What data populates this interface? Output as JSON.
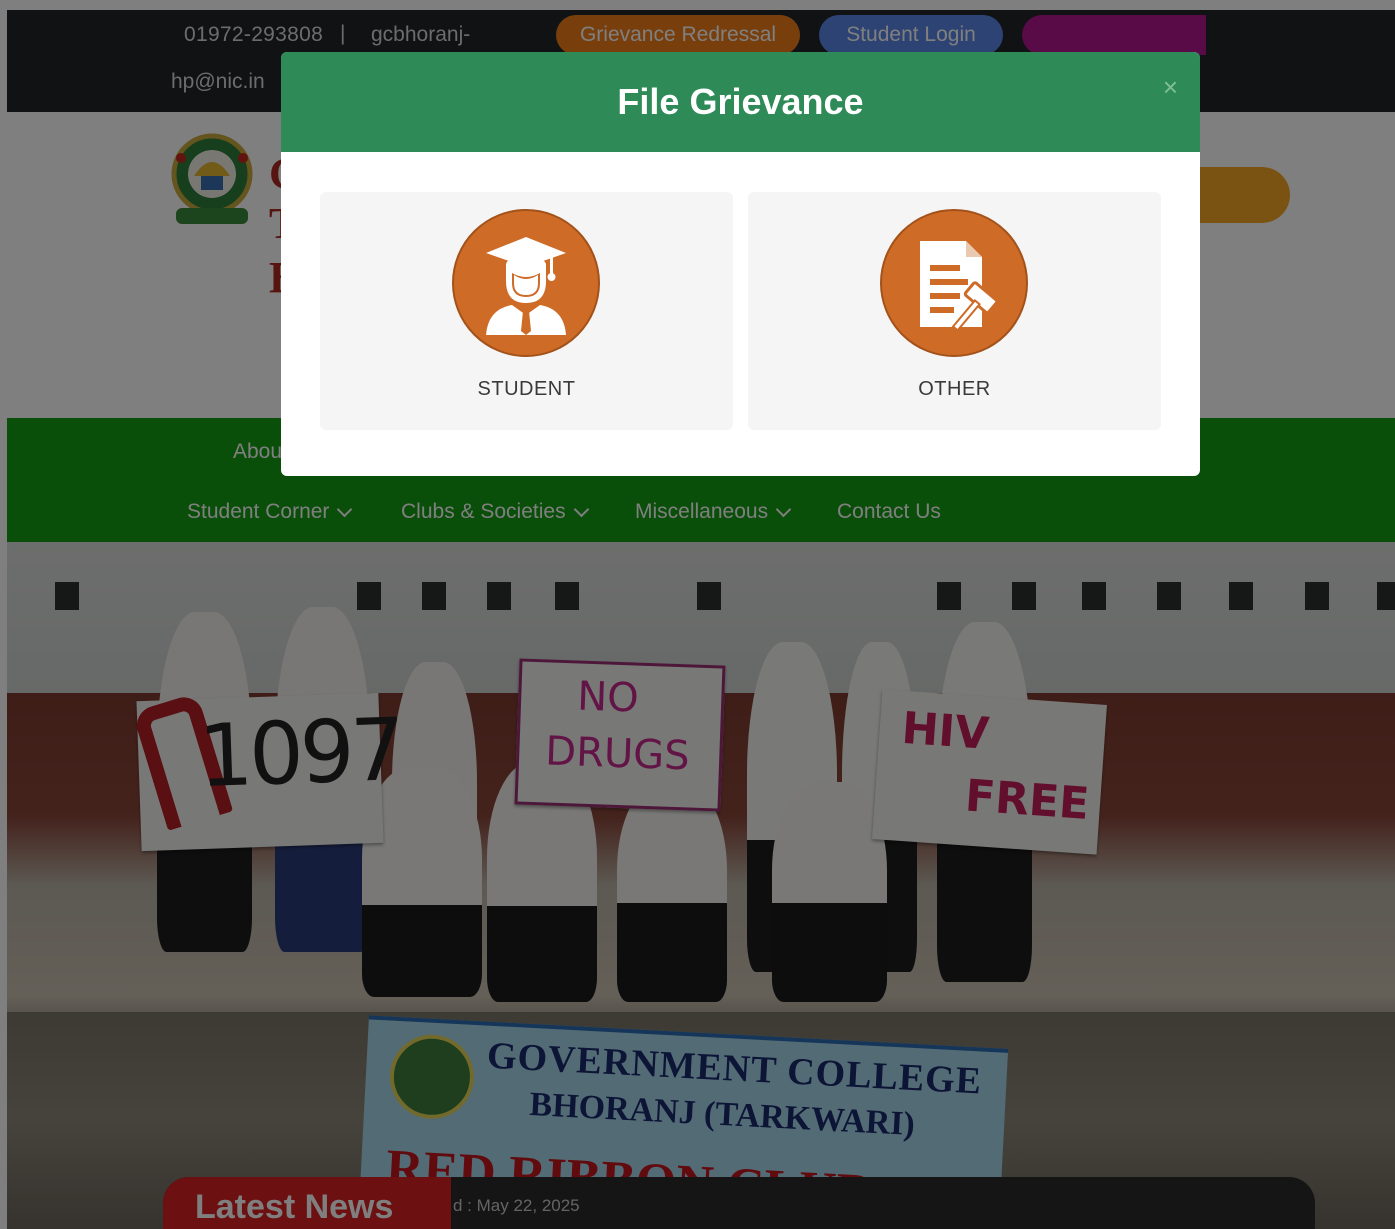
{
  "topbar": {
    "phone": "01972-293808",
    "separator": "|",
    "email_line1": "gcbhoranj-",
    "email_line2": "hp@nic.in",
    "grievance_button": "Grievance Redressal",
    "student_login_button": "Student Login"
  },
  "header": {
    "title_fragment_1": "G",
    "title_fragment_2": "T",
    "title_fragment_3": "B"
  },
  "nav": {
    "about_fragment": "Abou",
    "items": [
      {
        "label": "Student Corner",
        "has_dropdown": true
      },
      {
        "label": "Clubs & Societies",
        "has_dropdown": true
      },
      {
        "label": "Miscellaneous",
        "has_dropdown": true
      },
      {
        "label": "Contact Us",
        "has_dropdown": false
      }
    ]
  },
  "hero": {
    "sign_1": "1097",
    "sign_2_line1": "NO",
    "sign_2_line2": "DRUGS",
    "sign_3_line1": "HIV",
    "sign_3_line2": "FREE",
    "banner_line1": "GOVERNMENT COLLEGE",
    "banner_line2": "BHORANJ (TARKWARI)",
    "banner_line3": "RED RIBBON CLUB"
  },
  "news": {
    "label": "Latest News",
    "date_text": "d : May 22, 2025"
  },
  "modal": {
    "title": "File Grievance",
    "close_symbol": "×",
    "options": [
      {
        "label": "STUDENT",
        "icon": "graduate-icon"
      },
      {
        "label": "OTHER",
        "icon": "document-gavel-icon"
      }
    ]
  },
  "colors": {
    "modal_header": "#2e8b57",
    "icon_circle": "#cd6b27",
    "nav_green": "#129c12",
    "grievance_orange": "#f07f1a",
    "login_blue": "#5a87e8",
    "news_red": "#d82124"
  }
}
